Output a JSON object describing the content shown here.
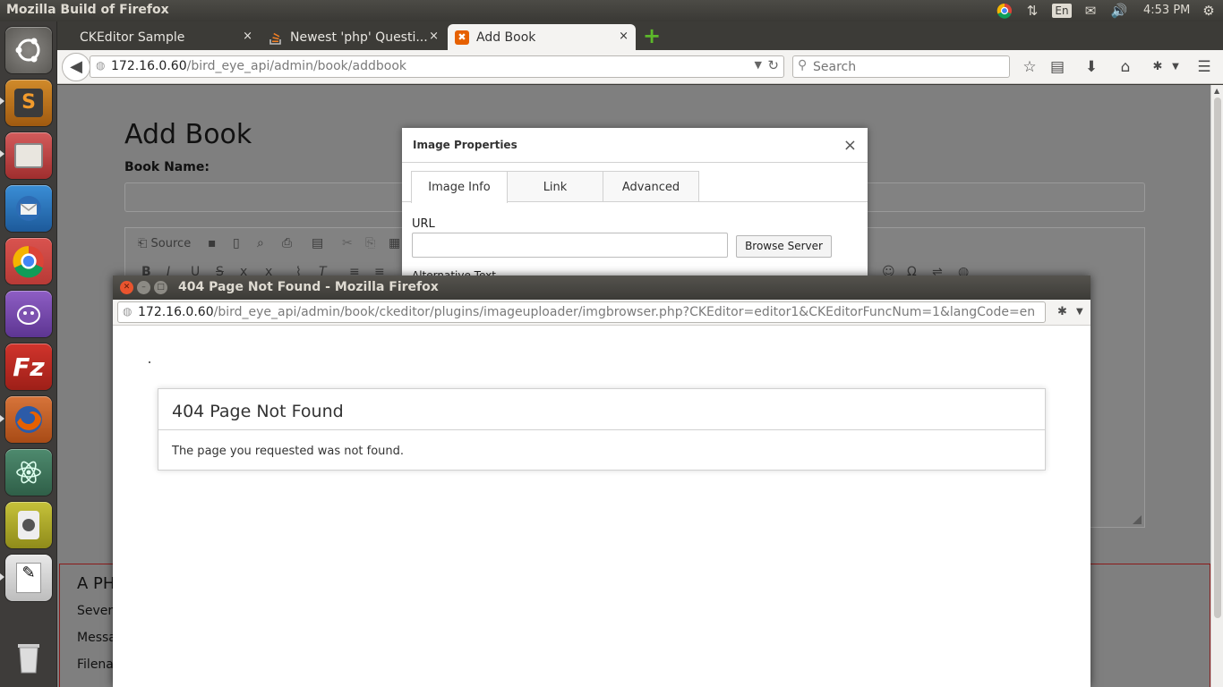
{
  "os": {
    "app_title": "Mozilla Build of Firefox",
    "keyboard_indicator": "En",
    "clock": "4:53 PM"
  },
  "browser": {
    "tabs": [
      {
        "label": "CKEditor Sample",
        "close": "×"
      },
      {
        "label": "Newest 'php' Questi...",
        "close": "×"
      },
      {
        "label": "Add Book",
        "close": "×"
      }
    ],
    "new_tab": "+",
    "url_host": "172.16.0.60",
    "url_path": "/bird_eye_api/admin/book/addbook",
    "search_placeholder": "Search"
  },
  "page": {
    "heading": "Add Book",
    "book_name_label": "Book Name:",
    "source_button": "Source",
    "error_panel_title": "A PH",
    "error_lines": [
      "Severi",
      "Messa",
      "Filena"
    ]
  },
  "image_dialog": {
    "title": "Image Properties",
    "close": "×",
    "tabs": [
      "Image Info",
      "Link",
      "Advanced"
    ],
    "url_label": "URL",
    "browse_button": "Browse Server",
    "alt_label": "Alternative Text"
  },
  "popup": {
    "title": "404 Page Not Found - Mozilla Firefox",
    "url_host": "172.16.0.60",
    "url_path": "/bird_eye_api/admin/book/ckeditor/plugins/imageuploader/imgbrowser.php?CKEditor=editor1&CKEditorFuncNum=1&langCode=en",
    "error_heading": "404 Page Not Found",
    "error_message": "The page you requested was not found."
  },
  "colors": {
    "firefox_tab_icon": "#e66000",
    "dialog_bg": "#ffffff",
    "page_overlay": "#7f7f7f",
    "error_border": "#8b1a1a"
  }
}
